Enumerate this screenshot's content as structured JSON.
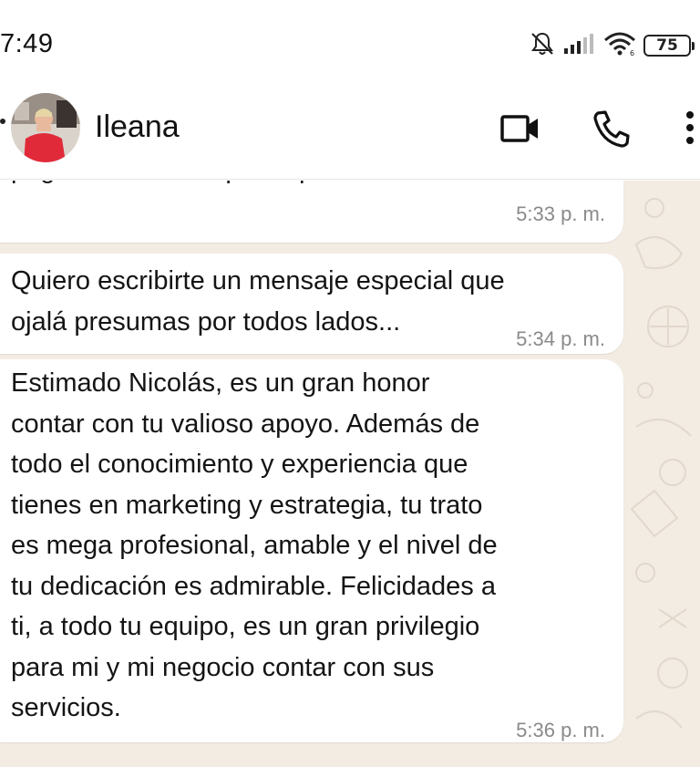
{
  "status_bar": {
    "time": "7:49",
    "battery": "75",
    "icons": [
      "bell-muted-icon",
      "signal-icon",
      "wifi-icon",
      "battery-icon"
    ]
  },
  "header": {
    "contact_name": "Ileana",
    "icons": [
      "back-arrow-icon",
      "video-call-icon",
      "voice-call-icon",
      "more-menu-icon"
    ]
  },
  "messages": [
    {
      "text": "página web el template que deben usar?",
      "time": "5:33 p. m."
    },
    {
      "text": "Quiero escribirte un mensaje especial que\nojalá presumas por todos lados...",
      "time": "5:34 p. m."
    },
    {
      "text": "Estimado Nicolás, es un gran honor\ncontar con tu valioso apoyo. Además de\ntodo el conocimiento y experiencia que\ntienes en marketing y estrategia, tu trato\nes mega profesional, amable y el nivel de\ntu dedicación es admirable. Felicidades a\nti, a todo tu equipo, es un gran privilegio\npara mi y mi negocio contar con sus\nservicios.",
      "time": "5:36 p. m."
    }
  ],
  "colors": {
    "chat_background": "#f3ece3",
    "bubble": "#ffffff",
    "timestamp": "#8a8a8a"
  }
}
